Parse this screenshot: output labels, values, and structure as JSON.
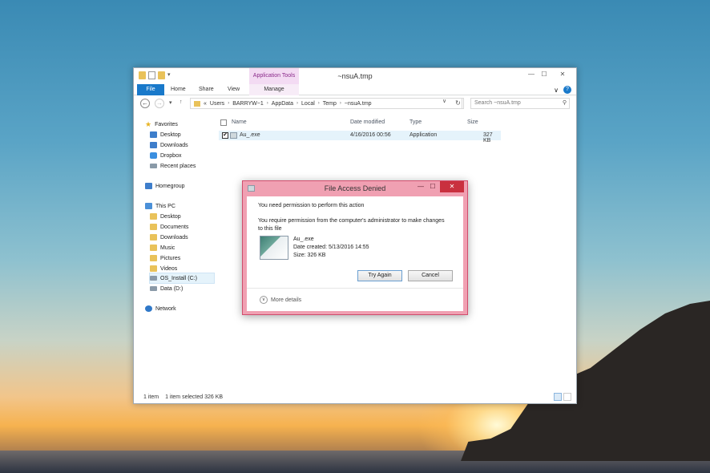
{
  "window": {
    "title": "~nsuA.tmp",
    "application_tools": "Application Tools",
    "controls": {
      "minimize": "—",
      "maximize": "☐",
      "close": "✕"
    }
  },
  "ribbon": {
    "tabs": [
      "File",
      "Home",
      "Share",
      "View",
      "Manage"
    ],
    "chevron": "∨",
    "help": "?"
  },
  "navigation": {
    "back": "←",
    "forward": "→",
    "recent": "▾",
    "up": "↑",
    "address": [
      "«",
      "Users",
      "BARRYW~1",
      "AppData",
      "Local",
      "Temp",
      "~nsuA.tmp"
    ],
    "address_dropdown": "∨",
    "refresh": "↻",
    "search_placeholder": "Search ~nsuA.tmp",
    "search_icon": "⚲"
  },
  "sidebar": {
    "favorites": "Favorites",
    "favorites_items": [
      "Desktop",
      "Downloads",
      "Dropbox",
      "Recent places"
    ],
    "homegroup": "Homegroup",
    "thispc": "This PC",
    "thispc_items": [
      "Desktop",
      "Documents",
      "Downloads",
      "Music",
      "Pictures",
      "Videos",
      "OS_Install (C:)",
      "Data (D:)"
    ],
    "network": "Network"
  },
  "files": {
    "columns": [
      "Name",
      "Date modified",
      "Type",
      "Size"
    ],
    "rows": [
      {
        "check": "✔",
        "name": "Au_.exe",
        "date": "4/16/2016 00:56",
        "type": "Application",
        "size": "327 KB"
      }
    ]
  },
  "status": {
    "items": "1 item",
    "selected": "1 item selected  326 KB"
  },
  "dialog": {
    "title": "File Access Denied",
    "controls": {
      "minimize": "—",
      "maximize": "☐",
      "close": "✕"
    },
    "line1": "You need permission to perform this action",
    "line2": "You require permission from the computer's administrator to make changes to this file",
    "file_name": "Au_.exe",
    "date_created": "Date created: 5/13/2016 14:55",
    "size": "Size: 326 KB",
    "try_again": "Try Again",
    "cancel": "Cancel",
    "more_details": "More details",
    "more_icon": "∨"
  }
}
